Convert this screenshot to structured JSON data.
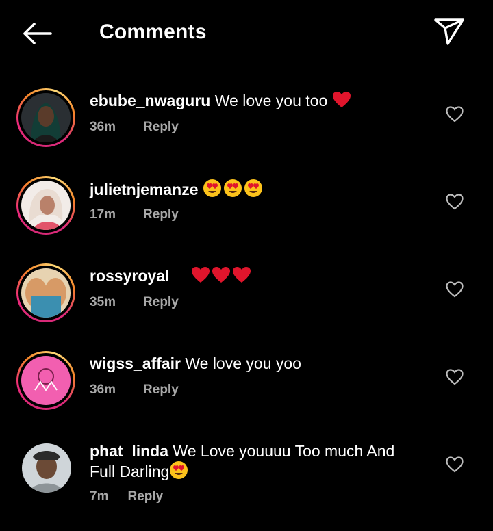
{
  "header": {
    "title": "Comments",
    "back_icon": "arrow-left-icon",
    "send_icon": "paper-plane-icon"
  },
  "colors": {
    "background": "#000000",
    "text": "#ffffff",
    "secondary_text": "#a8a8a8",
    "heart_red": "#e0152c",
    "story_ring_start": "#d62976",
    "story_ring_end": "#feda77"
  },
  "comments": [
    {
      "username": "ebube_nwaguru",
      "text": "We love you too",
      "emojis": "heart",
      "time": "36m",
      "reply": "Reply",
      "has_story_ring": true
    },
    {
      "username": "julietnjemanze",
      "text": "",
      "emojis": "heart-eyes x3",
      "time": "17m",
      "reply": "Reply",
      "has_story_ring": true
    },
    {
      "username": "rossyroyal__",
      "text": "",
      "emojis": "heart x3",
      "time": "35m",
      "reply": "Reply",
      "has_story_ring": true
    },
    {
      "username": "wigss_affair",
      "text": "We love you yoo",
      "emojis": "",
      "time": "36m",
      "reply": "Reply",
      "has_story_ring": true
    },
    {
      "username": "phat_linda",
      "text": "We Love youuuu Too much And",
      "text_line2": "Full Darling",
      "emojis": "heart-eyes",
      "time": "7m",
      "reply": "Reply",
      "has_story_ring": false
    }
  ]
}
